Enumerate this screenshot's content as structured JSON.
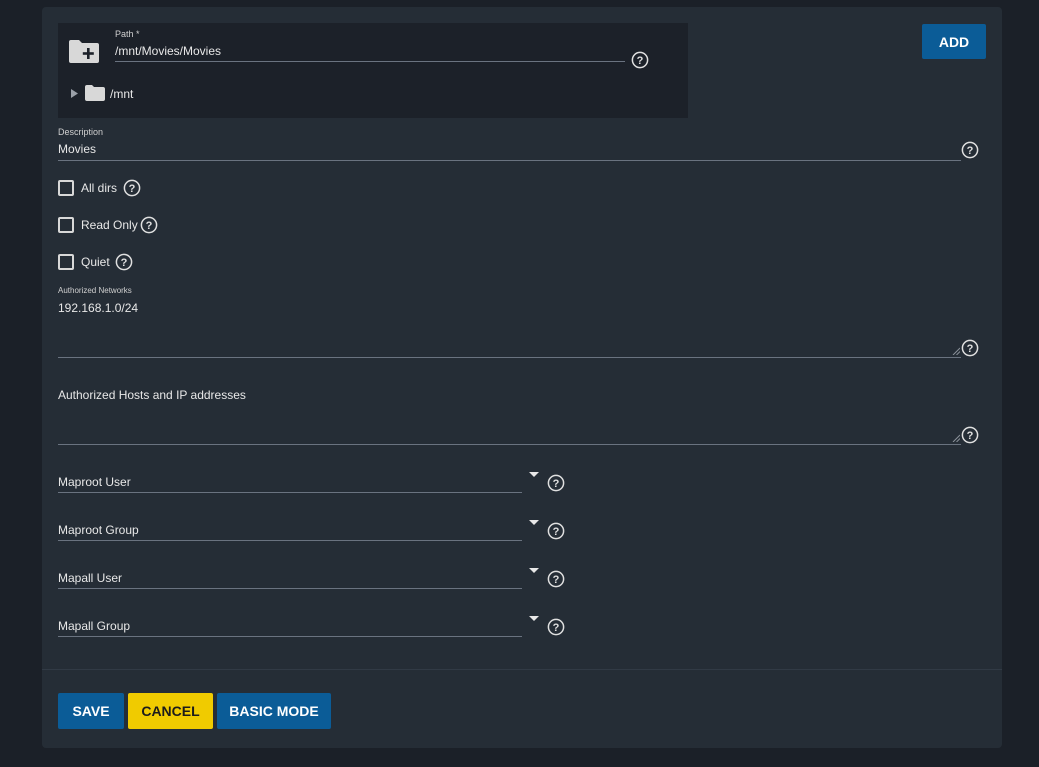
{
  "path_field": {
    "label": "Path *",
    "value": "/mnt/Movies/Movies",
    "tree_root": "/mnt"
  },
  "add_button": "ADD",
  "description": {
    "label": "Description",
    "value": "Movies"
  },
  "checkboxes": {
    "all_dirs": "All dirs",
    "read_only": "Read Only",
    "quiet": "Quiet"
  },
  "authorized_networks": {
    "label": "Authorized Networks",
    "value": "192.168.1.0/24"
  },
  "authorized_hosts": {
    "label": "Authorized Hosts and IP addresses"
  },
  "selects": {
    "maproot_user": "Maproot User",
    "maproot_group": "Maproot Group",
    "mapall_user": "Mapall User",
    "mapall_group": "Mapall Group"
  },
  "actions": {
    "save": "SAVE",
    "cancel": "CANCEL",
    "basic_mode": "BASIC MODE"
  },
  "colors": {
    "background": "#1b2028",
    "card": "#252d36",
    "primary": "#0b5c97",
    "warning": "#f0cb00"
  }
}
